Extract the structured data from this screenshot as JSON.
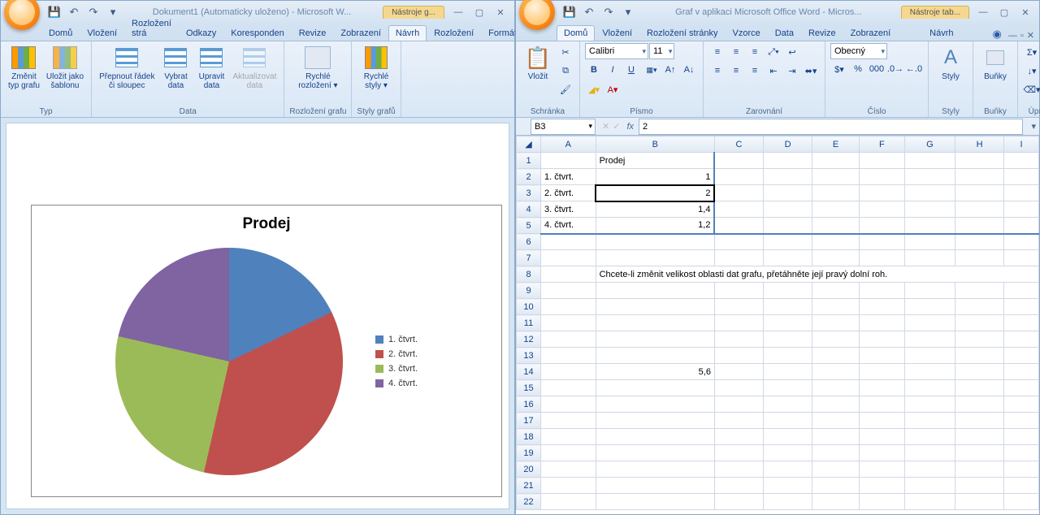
{
  "left": {
    "title": "Dokument1 (Automaticky uloženo) - Microsoft W...",
    "context_tab": "Nástroje g...",
    "tabs": [
      "Domů",
      "Vložení",
      "Rozložení strá",
      "Odkazy",
      "Koresponden",
      "Revize",
      "Zobrazení",
      "Návrh",
      "Rozložení",
      "Formát"
    ],
    "active_tab": "Návrh",
    "groups": {
      "typ": {
        "label": "Typ",
        "btn1": "Změnit\ntyp grafu",
        "btn2": "Uložit jako\nšablonu"
      },
      "data": {
        "label": "Data",
        "b1": "Přepnout řádek\nči sloupec",
        "b2": "Vybrat\ndata",
        "b3": "Upravit\ndata",
        "b4": "Aktualizovat\ndata"
      },
      "rozlozeni": {
        "label": "Rozložení grafu",
        "b1": "Rychlé\nrozložení ▾"
      },
      "styly": {
        "label": "Styly grafů",
        "b1": "Rychlé\nstyly ▾"
      }
    }
  },
  "right": {
    "title": "Graf v aplikaci Microsoft Office Word - Micros...",
    "context_tab": "Nástroje tab...",
    "tabs": [
      "Domů",
      "Vložení",
      "Rozložení stránky",
      "Vzorce",
      "Data",
      "Revize",
      "Zobrazení",
      "Návrh"
    ],
    "active_tab": "Domů",
    "groups": {
      "schranka": "Schránka",
      "pismo": "Písmo",
      "zarovnani": "Zarovnání",
      "cislo": "Číslo",
      "styly": "Styly",
      "bunky": "Buňky",
      "upravy": "Úpravy",
      "paste": "Vložit",
      "font_name": "Calibri",
      "font_size": "11",
      "num_format": "Obecný",
      "styly_btn": "Styly",
      "bunky_btn": "Buňky"
    },
    "name_box": "B3",
    "formula": "2",
    "columns": [
      "A",
      "B",
      "C",
      "D",
      "E",
      "F",
      "G",
      "H",
      "I"
    ],
    "rows": {
      "header_col": "Prodej",
      "r": [
        {
          "n": 2,
          "a": "1. čtvrt.",
          "b": "1"
        },
        {
          "n": 3,
          "a": "2. čtvrt.",
          "b": "2"
        },
        {
          "n": 4,
          "a": "3. čtvrt.",
          "b": "1,4"
        },
        {
          "n": 5,
          "a": "4. čtvrt.",
          "b": "1,2"
        }
      ],
      "hint": "Chcete-li změnit velikost oblasti dat grafu, přetáhněte její pravý dolní roh.",
      "b14": "5,6"
    }
  },
  "chart_data": {
    "type": "pie",
    "title": "Prodej",
    "categories": [
      "1. čtvrt.",
      "2. čtvrt.",
      "3. čtvrt.",
      "4. čtvrt."
    ],
    "values": [
      1,
      2,
      1.4,
      1.2
    ],
    "colors": [
      "#4f81bd",
      "#c0504d",
      "#9bbb59",
      "#8064a2"
    ],
    "legend_position": "right"
  }
}
